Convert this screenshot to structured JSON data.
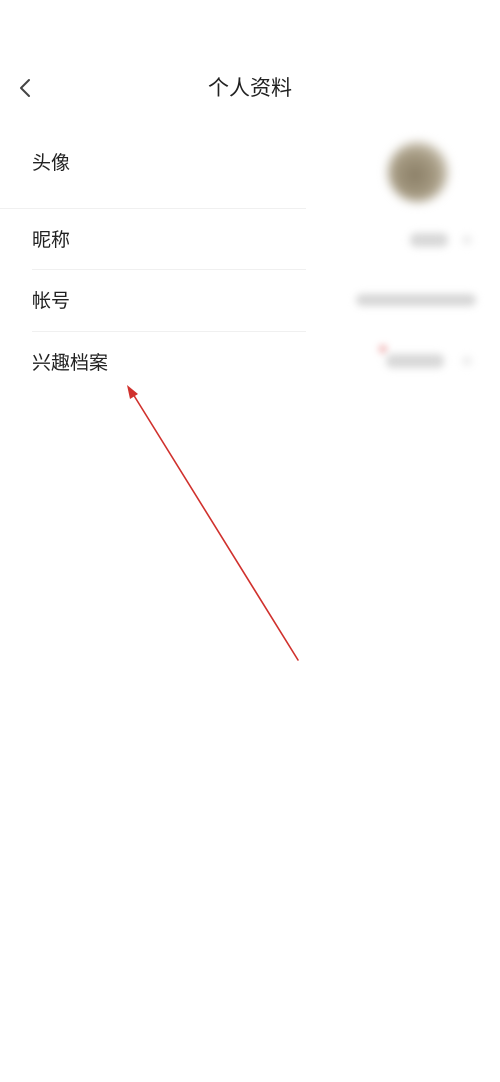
{
  "header": {
    "title": "个人资料"
  },
  "rows": [
    {
      "label": "头像"
    },
    {
      "label": "昵称"
    },
    {
      "label": "帐号"
    },
    {
      "label": "兴趣档案"
    }
  ],
  "annotation": {
    "arrow_color": "#d0312d"
  }
}
